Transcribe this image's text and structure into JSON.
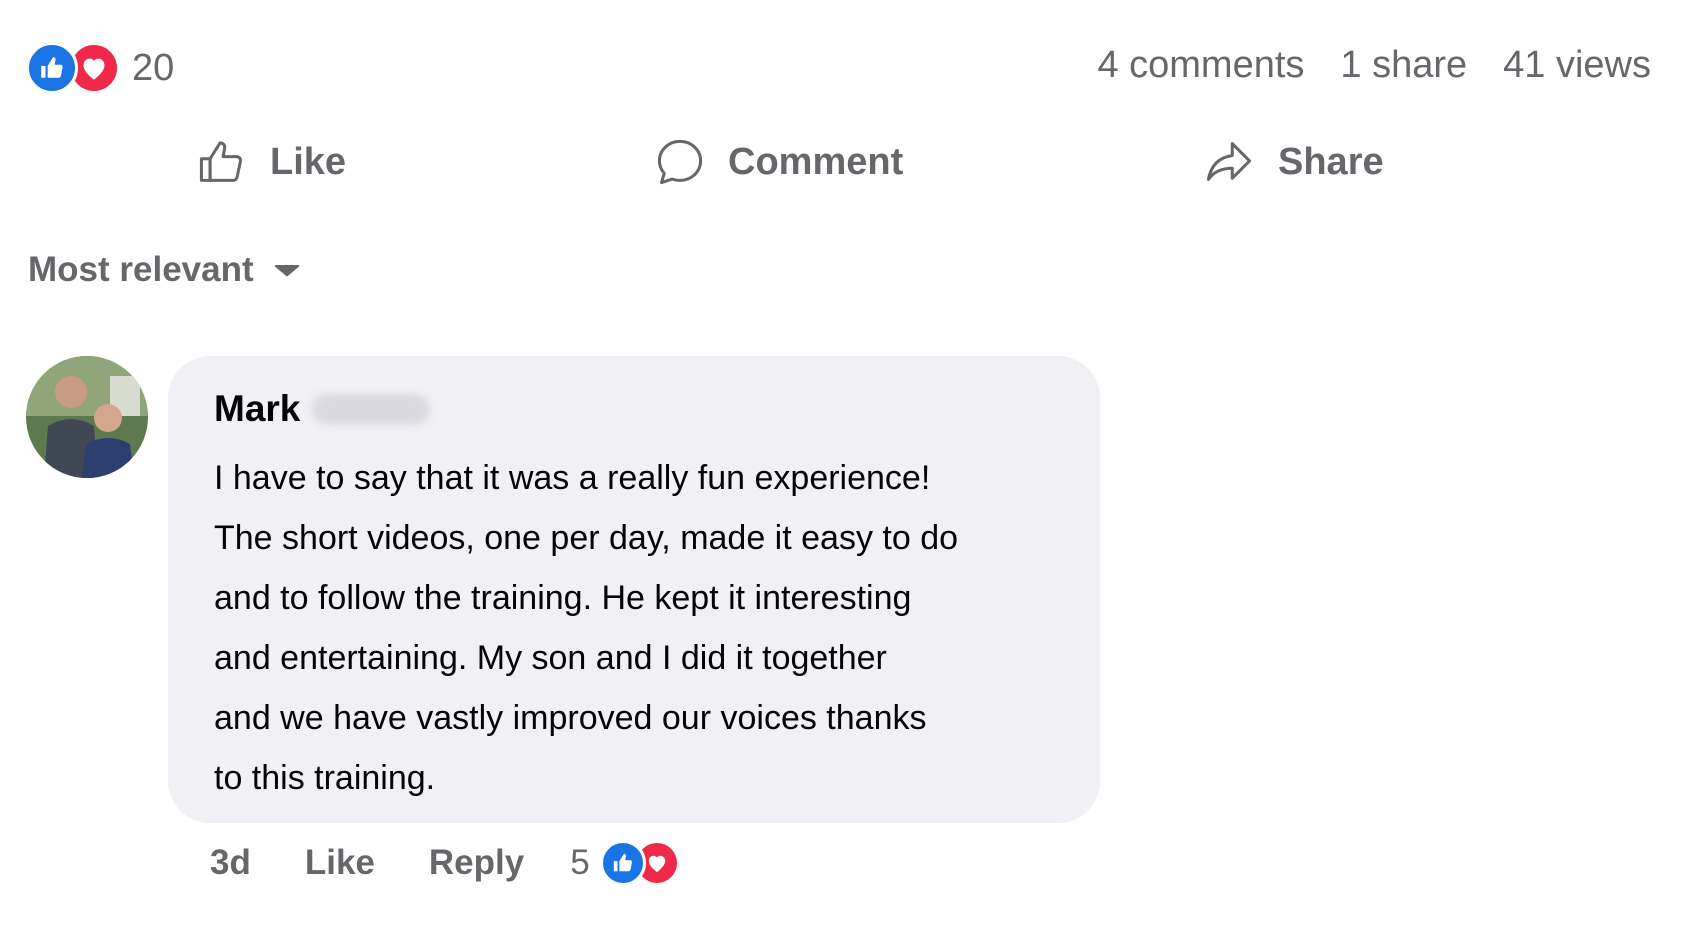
{
  "post_stats": {
    "reaction_icons": [
      "like-icon",
      "love-icon"
    ],
    "reaction_count": "20",
    "comments": "4 comments",
    "shares": "1 share",
    "views": "41 views"
  },
  "actions": {
    "like": "Like",
    "comment": "Comment",
    "share": "Share"
  },
  "sort": {
    "label": "Most relevant",
    "icon": "caret-down-icon"
  },
  "comment": {
    "author": "Mark",
    "lines": [
      "I have to say that it was a really fun experience!",
      "The short videos, one per day, made it easy to do",
      "and to follow the training. He kept it interesting",
      "and entertaining. My son and I did it together",
      "and we have vastly improved our voices thanks",
      "to this training."
    ],
    "time": "3d",
    "like": "Like",
    "reply": "Reply",
    "reaction_count": "5",
    "reaction_icons": [
      "like-icon",
      "love-icon"
    ]
  },
  "colors": {
    "like_blue": "#1b74e4",
    "love_red": "#f0284a",
    "secondary_text": "#65676b",
    "bubble_bg": "#f0f0f5"
  }
}
